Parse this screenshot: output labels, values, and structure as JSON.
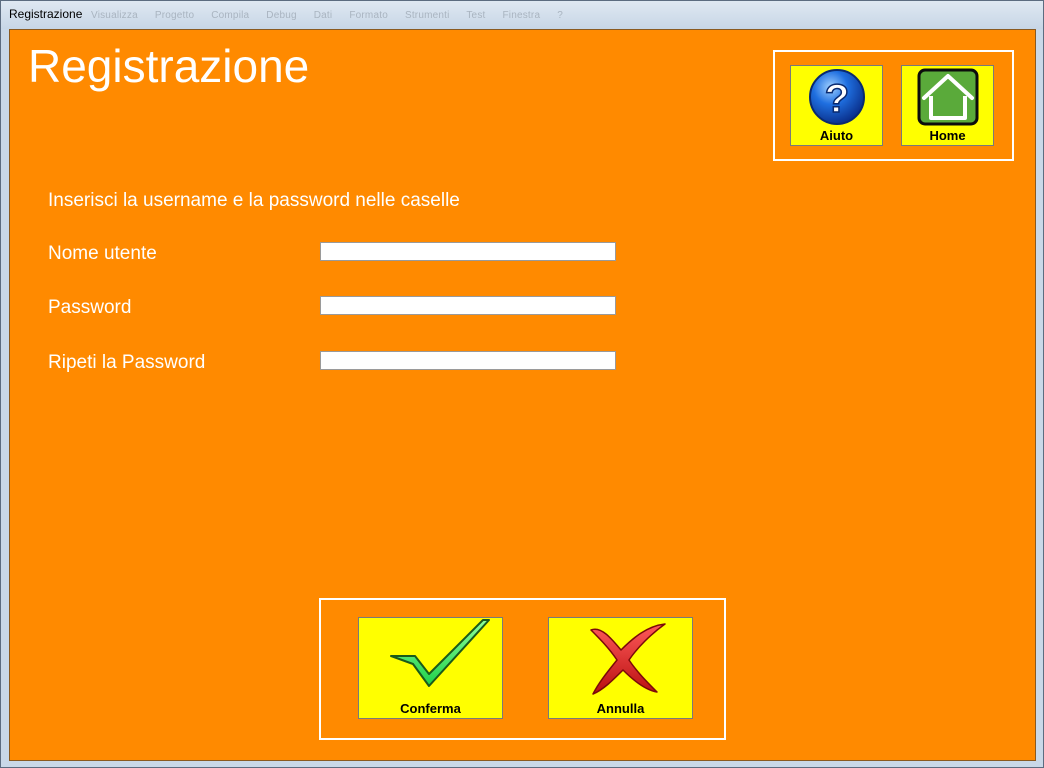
{
  "window": {
    "title": "Registrazione",
    "ghost_menu": [
      "Visualizza",
      "Progetto",
      "Compila",
      "Debug",
      "Dati",
      "Formato",
      "Strumenti",
      "Test",
      "Finestra",
      "?"
    ]
  },
  "page": {
    "title": "Registrazione",
    "instructions": "Inserisci la username e la password nelle caselle"
  },
  "form": {
    "username_label": "Nome utente",
    "username_value": "",
    "password_label": "Password",
    "password_value": "",
    "repeat_password_label": "Ripeti la Password",
    "repeat_password_value": ""
  },
  "top_buttons": {
    "help_label": "Aiuto",
    "home_label": "Home"
  },
  "bottom_buttons": {
    "confirm_label": "Conferma",
    "cancel_label": "Annulla"
  },
  "colors": {
    "background": "#ff8a00",
    "tile": "#ffff00",
    "text": "#ffffff"
  },
  "icons": {
    "help": "help-question-icon",
    "home": "home-icon",
    "confirm": "checkmark-icon",
    "cancel": "cross-icon"
  }
}
